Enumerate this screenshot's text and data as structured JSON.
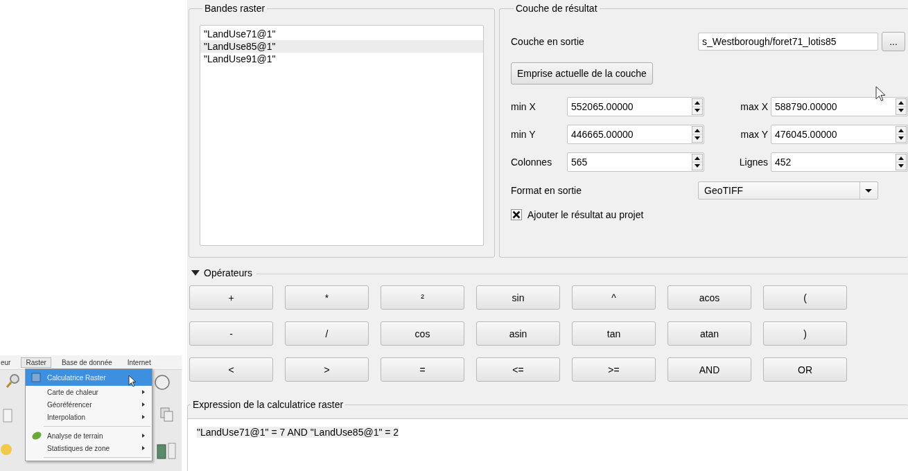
{
  "bands": {
    "title": "Bandes raster",
    "items": [
      {
        "label": "\"LandUse71@1\"",
        "selected": false
      },
      {
        "label": "\"LandUse85@1\"",
        "selected": true
      },
      {
        "label": "\"LandUse91@1\"",
        "selected": false
      }
    ]
  },
  "result": {
    "title": "Couche de résultat",
    "output_label": "Couche en sortie",
    "output_value": "s_Westborough/foret71_lotis85",
    "browse_button": "...",
    "extent_button": "Emprise actuelle de la couche",
    "fields": [
      {
        "label": "min X",
        "value": "552065.00000"
      },
      {
        "label": "max X",
        "value": "588790.00000"
      },
      {
        "label": "min Y",
        "value": "446665.00000"
      },
      {
        "label": "max Y",
        "value": "476045.00000"
      },
      {
        "label": "Colonnes",
        "value": "565"
      },
      {
        "label": "Lignes",
        "value": "452"
      }
    ],
    "format_label": "Format en sortie",
    "format_value": "GeoTIFF",
    "add_to_project": {
      "label": "Ajouter le résultat au projet",
      "checked": true
    }
  },
  "operators": {
    "title": "Opérateurs",
    "expanded": true,
    "buttons": [
      "+",
      "*",
      "²",
      "sin",
      "^",
      "acos",
      "(",
      "-",
      "/",
      "cos",
      "asin",
      "tan",
      "atan",
      ")",
      "<",
      ">",
      "=",
      "<=",
      ">=",
      "AND",
      "OR"
    ]
  },
  "expression": {
    "title": "Expression de la calculatrice raster",
    "value": "\"LandUse71@1\" = 7 AND \"LandUse85@1\" = 2",
    "highlighted": true
  },
  "inset": {
    "menu_bar": [
      {
        "label": "eur",
        "selected": false
      },
      {
        "label": "Raster",
        "selected": true
      },
      {
        "label": "Base de donnée",
        "selected": false
      },
      {
        "label": "Internet",
        "selected": false
      }
    ],
    "menu_items": [
      {
        "kind": "item",
        "label": "Calculatrice Raster",
        "selected": true,
        "submenu": false,
        "icon": true
      },
      {
        "kind": "item",
        "label": "Carte de chaleur",
        "selected": false,
        "submenu": true,
        "icon": false
      },
      {
        "kind": "item",
        "label": "Géoréférencer",
        "selected": false,
        "submenu": true,
        "icon": false
      },
      {
        "kind": "item",
        "label": "Interpolation",
        "selected": false,
        "submenu": true,
        "icon": false
      },
      {
        "kind": "separator"
      },
      {
        "kind": "item",
        "label": "Analyse de terrain",
        "selected": false,
        "submenu": true,
        "icon": true
      },
      {
        "kind": "item",
        "label": "Statistiques de zone",
        "selected": false,
        "submenu": true,
        "icon": false
      },
      {
        "kind": "separator"
      }
    ]
  }
}
